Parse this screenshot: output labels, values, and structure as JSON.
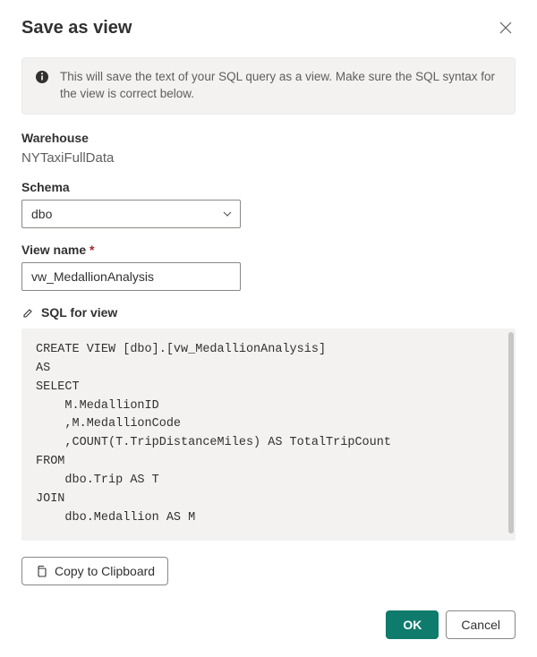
{
  "dialog": {
    "title": "Save as view",
    "close_aria": "Close"
  },
  "info": {
    "message": "This will save the text of your SQL query as a view. Make sure the SQL syntax for the view is correct below."
  },
  "warehouse": {
    "label": "Warehouse",
    "value": "NYTaxiFullData"
  },
  "schema": {
    "label": "Schema",
    "value": "dbo"
  },
  "viewname": {
    "label": "View name",
    "required_marker": "*",
    "value": "vw_MedallionAnalysis"
  },
  "sql": {
    "label": "SQL for view",
    "code": "CREATE VIEW [dbo].[vw_MedallionAnalysis]\nAS\nSELECT\n    M.MedallionID\n    ,M.MedallionCode\n    ,COUNT(T.TripDistanceMiles) AS TotalTripCount\nFROM\n    dbo.Trip AS T\nJOIN\n    dbo.Medallion AS M"
  },
  "buttons": {
    "copy": "Copy to Clipboard",
    "ok": "OK",
    "cancel": "Cancel"
  }
}
